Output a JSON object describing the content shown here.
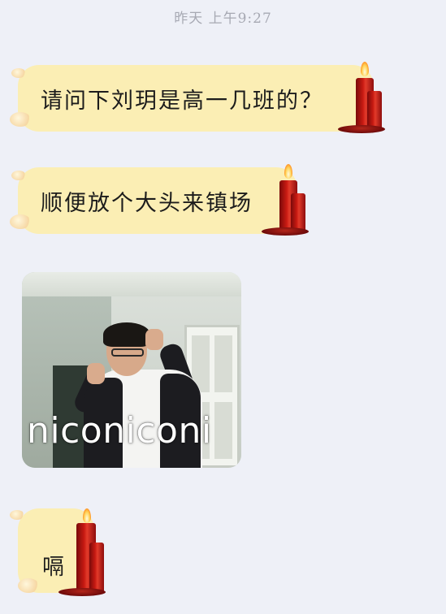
{
  "timestamp": "昨天 上午9:27",
  "messages": [
    {
      "text": "请问下刘玥是高一几班的？"
    },
    {
      "text": "顺便放个大头来镇场"
    },
    {
      "image_caption": "niconiconi"
    },
    {
      "text": "嗝"
    }
  ],
  "colors": {
    "bubble": "#fbeeb4",
    "background": "#eef0f7",
    "candle": "#c81a12"
  },
  "icons": [
    "candle-icon"
  ]
}
